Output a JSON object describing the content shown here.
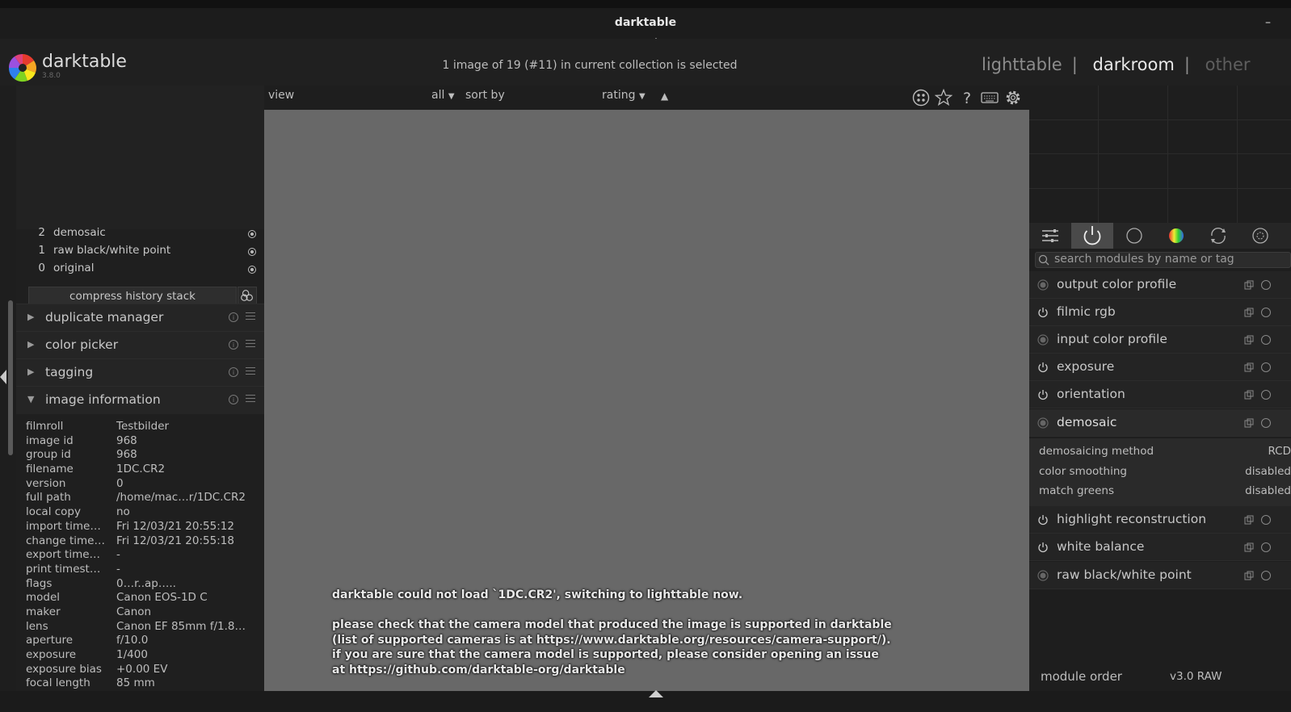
{
  "window": {
    "title": "darktable",
    "minimize_label": "–"
  },
  "header": {
    "app_name": "darktable",
    "app_version": "3.8.0",
    "selection_status": "1 image of 19 (#11) in current collection is selected",
    "views": [
      "lighttable",
      "darkroom",
      "other"
    ],
    "separator": "|",
    "active_view": "darkroom"
  },
  "toolbar": {
    "view_label": "view",
    "filter_value": "all",
    "sort_label": "sort by",
    "sort_value": "rating",
    "sort_direction_icon": "▲",
    "dropdown_icon": "▼",
    "icons": [
      "overlay-stars-icon",
      "star-icon",
      "help-icon",
      "keyboard-icon",
      "gear-icon"
    ]
  },
  "history": {
    "items": [
      {
        "num": "2",
        "name": "demosaic"
      },
      {
        "num": "1",
        "name": "raw black/white point"
      },
      {
        "num": "0",
        "name": "original"
      }
    ],
    "compress_label": "compress history stack"
  },
  "left_modules": [
    {
      "label": "duplicate manager",
      "expanded": false
    },
    {
      "label": "color picker",
      "expanded": false
    },
    {
      "label": "tagging",
      "expanded": false
    },
    {
      "label": "image information",
      "expanded": true
    }
  ],
  "arrow_collapsed": "▶",
  "arrow_expanded": "▼",
  "image_info": [
    {
      "k": "filmroll",
      "v": "Testbilder"
    },
    {
      "k": "image id",
      "v": "968"
    },
    {
      "k": "group id",
      "v": "968"
    },
    {
      "k": "filename",
      "v": "1DC.CR2"
    },
    {
      "k": "version",
      "v": "0"
    },
    {
      "k": "full path",
      "v": "/home/mac…r/1DC.CR2"
    },
    {
      "k": "local copy",
      "v": "no"
    },
    {
      "k": "import time…",
      "v": "Fri 12/03/21 20:55:12"
    },
    {
      "k": "change time…",
      "v": "Fri 12/03/21 20:55:18"
    },
    {
      "k": "export time…",
      "v": "-"
    },
    {
      "k": "print timest…",
      "v": "-"
    },
    {
      "k": "flags",
      "v": "0…r..ap….."
    },
    {
      "k": "model",
      "v": "Canon EOS-1D C"
    },
    {
      "k": "maker",
      "v": "Canon"
    },
    {
      "k": "lens",
      "v": "Canon EF 85mm f/1.8…"
    },
    {
      "k": "aperture",
      "v": "f/10.0"
    },
    {
      "k": "exposure",
      "v": "1/400"
    },
    {
      "k": "exposure bias",
      "v": "+0.00 EV"
    },
    {
      "k": "focal length",
      "v": "85 mm"
    }
  ],
  "error_message": [
    "darktable could not load `1DC.CR2', switching to lighttable now.",
    "",
    "please check that the camera model that produced the image is supported in darktable",
    "(list of supported cameras is at https://www.darktable.org/resources/camera-support/).",
    "if you are sure that the camera model is supported, please consider opening an issue",
    "at https://github.com/darktable-org/darktable"
  ],
  "right_panel": {
    "search_placeholder": "search modules by name or tag",
    "tab_icons": [
      "quick-access-icon",
      "active-modules-icon",
      "base-icon",
      "color-icon",
      "correct-icon",
      "effect-icon"
    ],
    "modules": [
      {
        "label": "output color profile",
        "power": "always-on"
      },
      {
        "label": "filmic rgb",
        "power": "on"
      },
      {
        "label": "input color profile",
        "power": "always-on"
      },
      {
        "label": "exposure",
        "power": "on"
      },
      {
        "label": "orientation",
        "power": "on"
      },
      {
        "label": "demosaic",
        "power": "always-on",
        "expanded": true
      },
      {
        "label": "highlight reconstruction",
        "power": "on"
      },
      {
        "label": "white balance",
        "power": "on"
      },
      {
        "label": "raw black/white point",
        "power": "always-on"
      }
    ],
    "demosaic_params": [
      {
        "k": "demosaicing method",
        "v": "RCD"
      },
      {
        "k": "color smoothing",
        "v": "disabled"
      },
      {
        "k": "match greens",
        "v": "disabled"
      }
    ],
    "module_order_label": "module order",
    "module_order_value": "v3.0 RAW"
  }
}
